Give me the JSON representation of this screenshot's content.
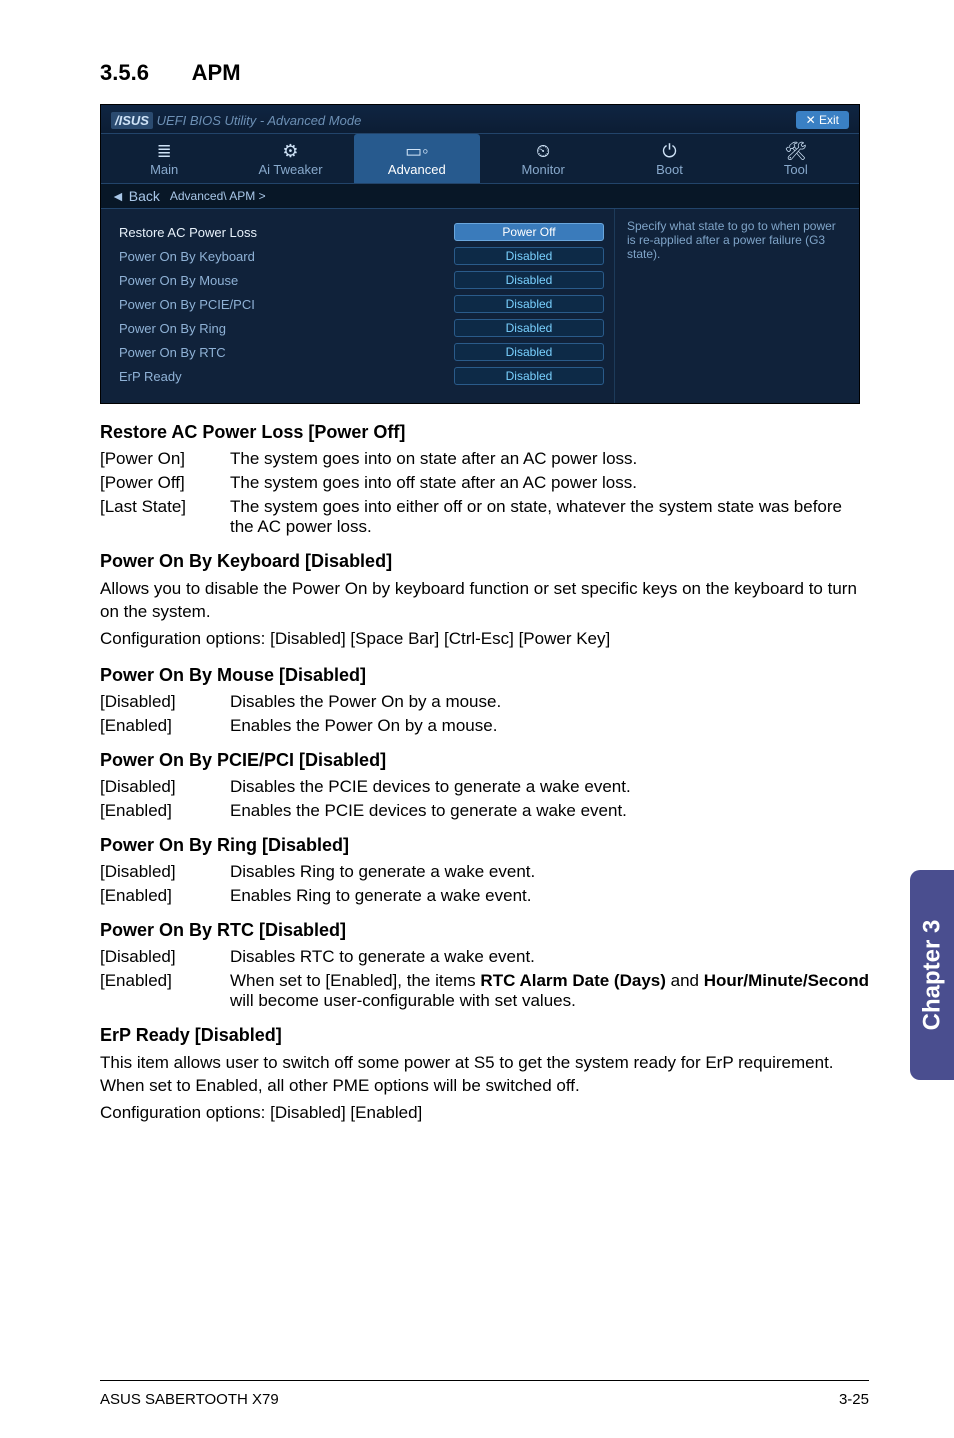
{
  "section": {
    "number": "3.5.6",
    "title": "APM"
  },
  "bios": {
    "titlebar": {
      "brand": "/ISUS",
      "title": "UEFI BIOS Utility - Advanced Mode",
      "exit": "Exit"
    },
    "tabs": [
      {
        "icon": "≣",
        "label": "Main"
      },
      {
        "icon": "⚙",
        "label": "Ai Tweaker"
      },
      {
        "icon": "▭◦",
        "label": "Advanced"
      },
      {
        "icon": "⏲",
        "label": "Monitor"
      },
      {
        "icon": "⏻",
        "label": "Boot"
      },
      {
        "icon": "🛠",
        "label": "Tool"
      }
    ],
    "breadcrumb": {
      "back": "Back",
      "path": "Advanced\\ APM >"
    },
    "rows": [
      {
        "label": "Restore AC Power Loss",
        "value": "Power Off",
        "hi": true
      },
      {
        "label": "Power On By Keyboard",
        "value": "Disabled"
      },
      {
        "label": "Power On By Mouse",
        "value": "Disabled"
      },
      {
        "label": "Power On By PCIE/PCI",
        "value": "Disabled"
      },
      {
        "label": "Power On By Ring",
        "value": "Disabled"
      },
      {
        "label": "Power On By RTC",
        "value": "Disabled"
      },
      {
        "label": "ErP Ready",
        "value": "Disabled"
      }
    ],
    "help": "Specify what state to go to when power is re-applied after a power failure (G3 state)."
  },
  "s_restore": {
    "heading": "Restore AC Power Loss [Power Off]",
    "opts": [
      {
        "k": "[Power On]",
        "v": "The system goes into on state after an AC power loss."
      },
      {
        "k": "[Power Off]",
        "v": "The system goes into off state after an AC power loss."
      },
      {
        "k": "[Last State]",
        "v": "The system goes into either off or on state, whatever the system state was before the AC power loss."
      }
    ]
  },
  "s_kb": {
    "heading": "Power On By Keyboard [Disabled]",
    "desc1": "Allows you to disable the Power On by keyboard function or set specific keys on the keyboard to turn on the system.",
    "desc2": "Configuration options: [Disabled] [Space Bar] [Ctrl-Esc] [Power Key]"
  },
  "s_mouse": {
    "heading": "Power On By Mouse [Disabled]",
    "opts": [
      {
        "k": "[Disabled]",
        "v": "Disables the Power On by a mouse."
      },
      {
        "k": "[Enabled]",
        "v": "Enables the Power On by a mouse."
      }
    ]
  },
  "s_pcie": {
    "heading": "Power On By PCIE/PCI [Disabled]",
    "opts": [
      {
        "k": "[Disabled]",
        "v": "Disables the PCIE devices to generate a wake event."
      },
      {
        "k": "[Enabled]",
        "v": "Enables the PCIE devices to generate a wake event."
      }
    ]
  },
  "s_ring": {
    "heading": "Power On By Ring [Disabled]",
    "opts": [
      {
        "k": "[Disabled]",
        "v": "Disables Ring to generate a wake event."
      },
      {
        "k": "[Enabled]",
        "v": "Enables Ring to generate a wake event."
      }
    ]
  },
  "s_rtc": {
    "heading": "Power On By RTC [Disabled]",
    "opts": [
      {
        "k": "[Disabled]",
        "v": "Disables RTC to generate a wake event."
      }
    ],
    "enabled_k": "[Enabled]",
    "enabled_pre": "When set to [Enabled], the items ",
    "enabled_b1": "RTC Alarm Date (Days)",
    "enabled_mid": " and ",
    "enabled_b2": "Hour/Minute/Second",
    "enabled_post": " will become user-configurable with set values."
  },
  "s_erp": {
    "heading": "ErP Ready [Disabled]",
    "desc1": "This item allows user to switch off some power at S5 to get the system ready for ErP requirement. When set to Enabled, all other PME options will be switched off.",
    "desc2": "Configuration options: [Disabled] [Enabled]"
  },
  "side": "Chapter 3",
  "footer": {
    "left": "ASUS SABERTOOTH X79",
    "right": "3-25"
  }
}
